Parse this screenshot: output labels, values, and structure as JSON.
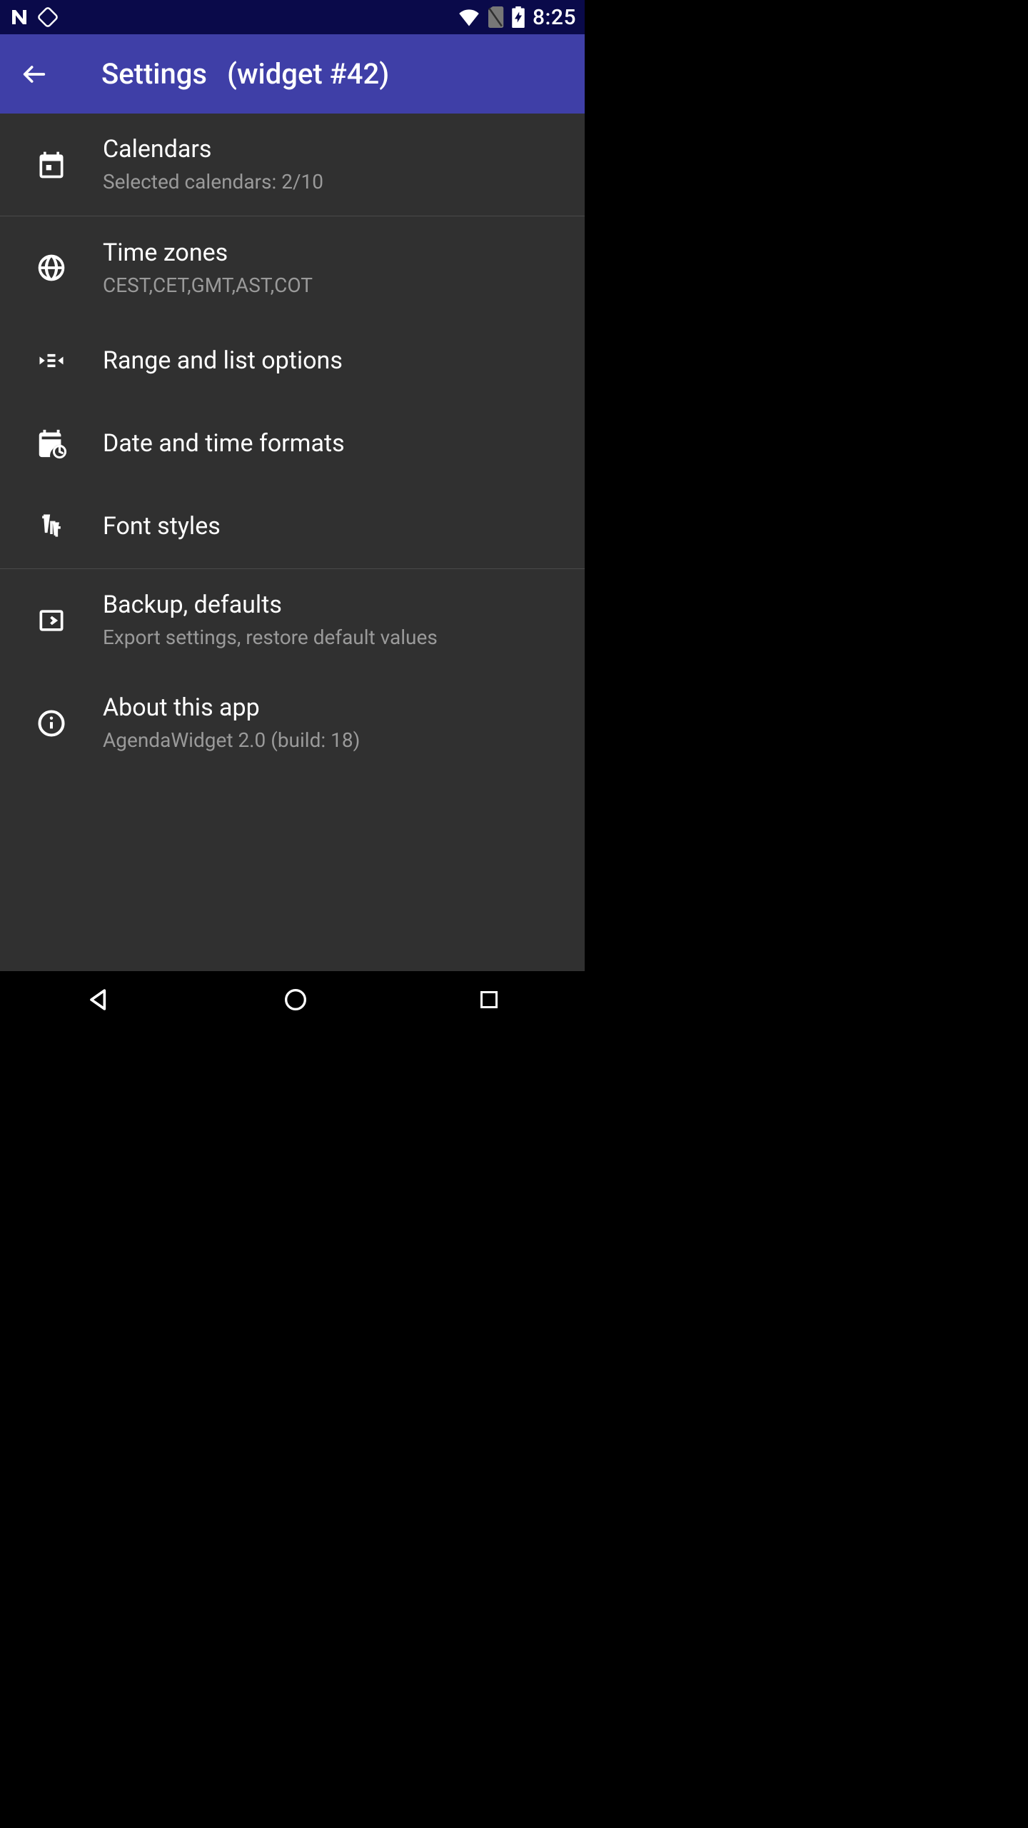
{
  "status": {
    "time": "8:25"
  },
  "appbar": {
    "title_main": "Settings",
    "title_widget": "(widget #42)"
  },
  "items": [
    {
      "title": "Calendars",
      "sub": "Selected calendars: 2/10"
    },
    {
      "title": "Time zones",
      "sub": "CEST,CET,GMT,AST,COT"
    },
    {
      "title": "Range and list options",
      "sub": ""
    },
    {
      "title": "Date and time formats",
      "sub": ""
    },
    {
      "title": "Font styles",
      "sub": ""
    },
    {
      "title": "Backup, defaults",
      "sub": "Export settings, restore default values"
    },
    {
      "title": "About this app",
      "sub": "AgendaWidget 2.0 (build: 18)"
    }
  ],
  "colors": {
    "appbar": "#3f3fa7",
    "statusbar": "#0a0a4a",
    "bg": "#303030",
    "text_primary": "#ffffff",
    "text_secondary": "#9a9a9a"
  }
}
